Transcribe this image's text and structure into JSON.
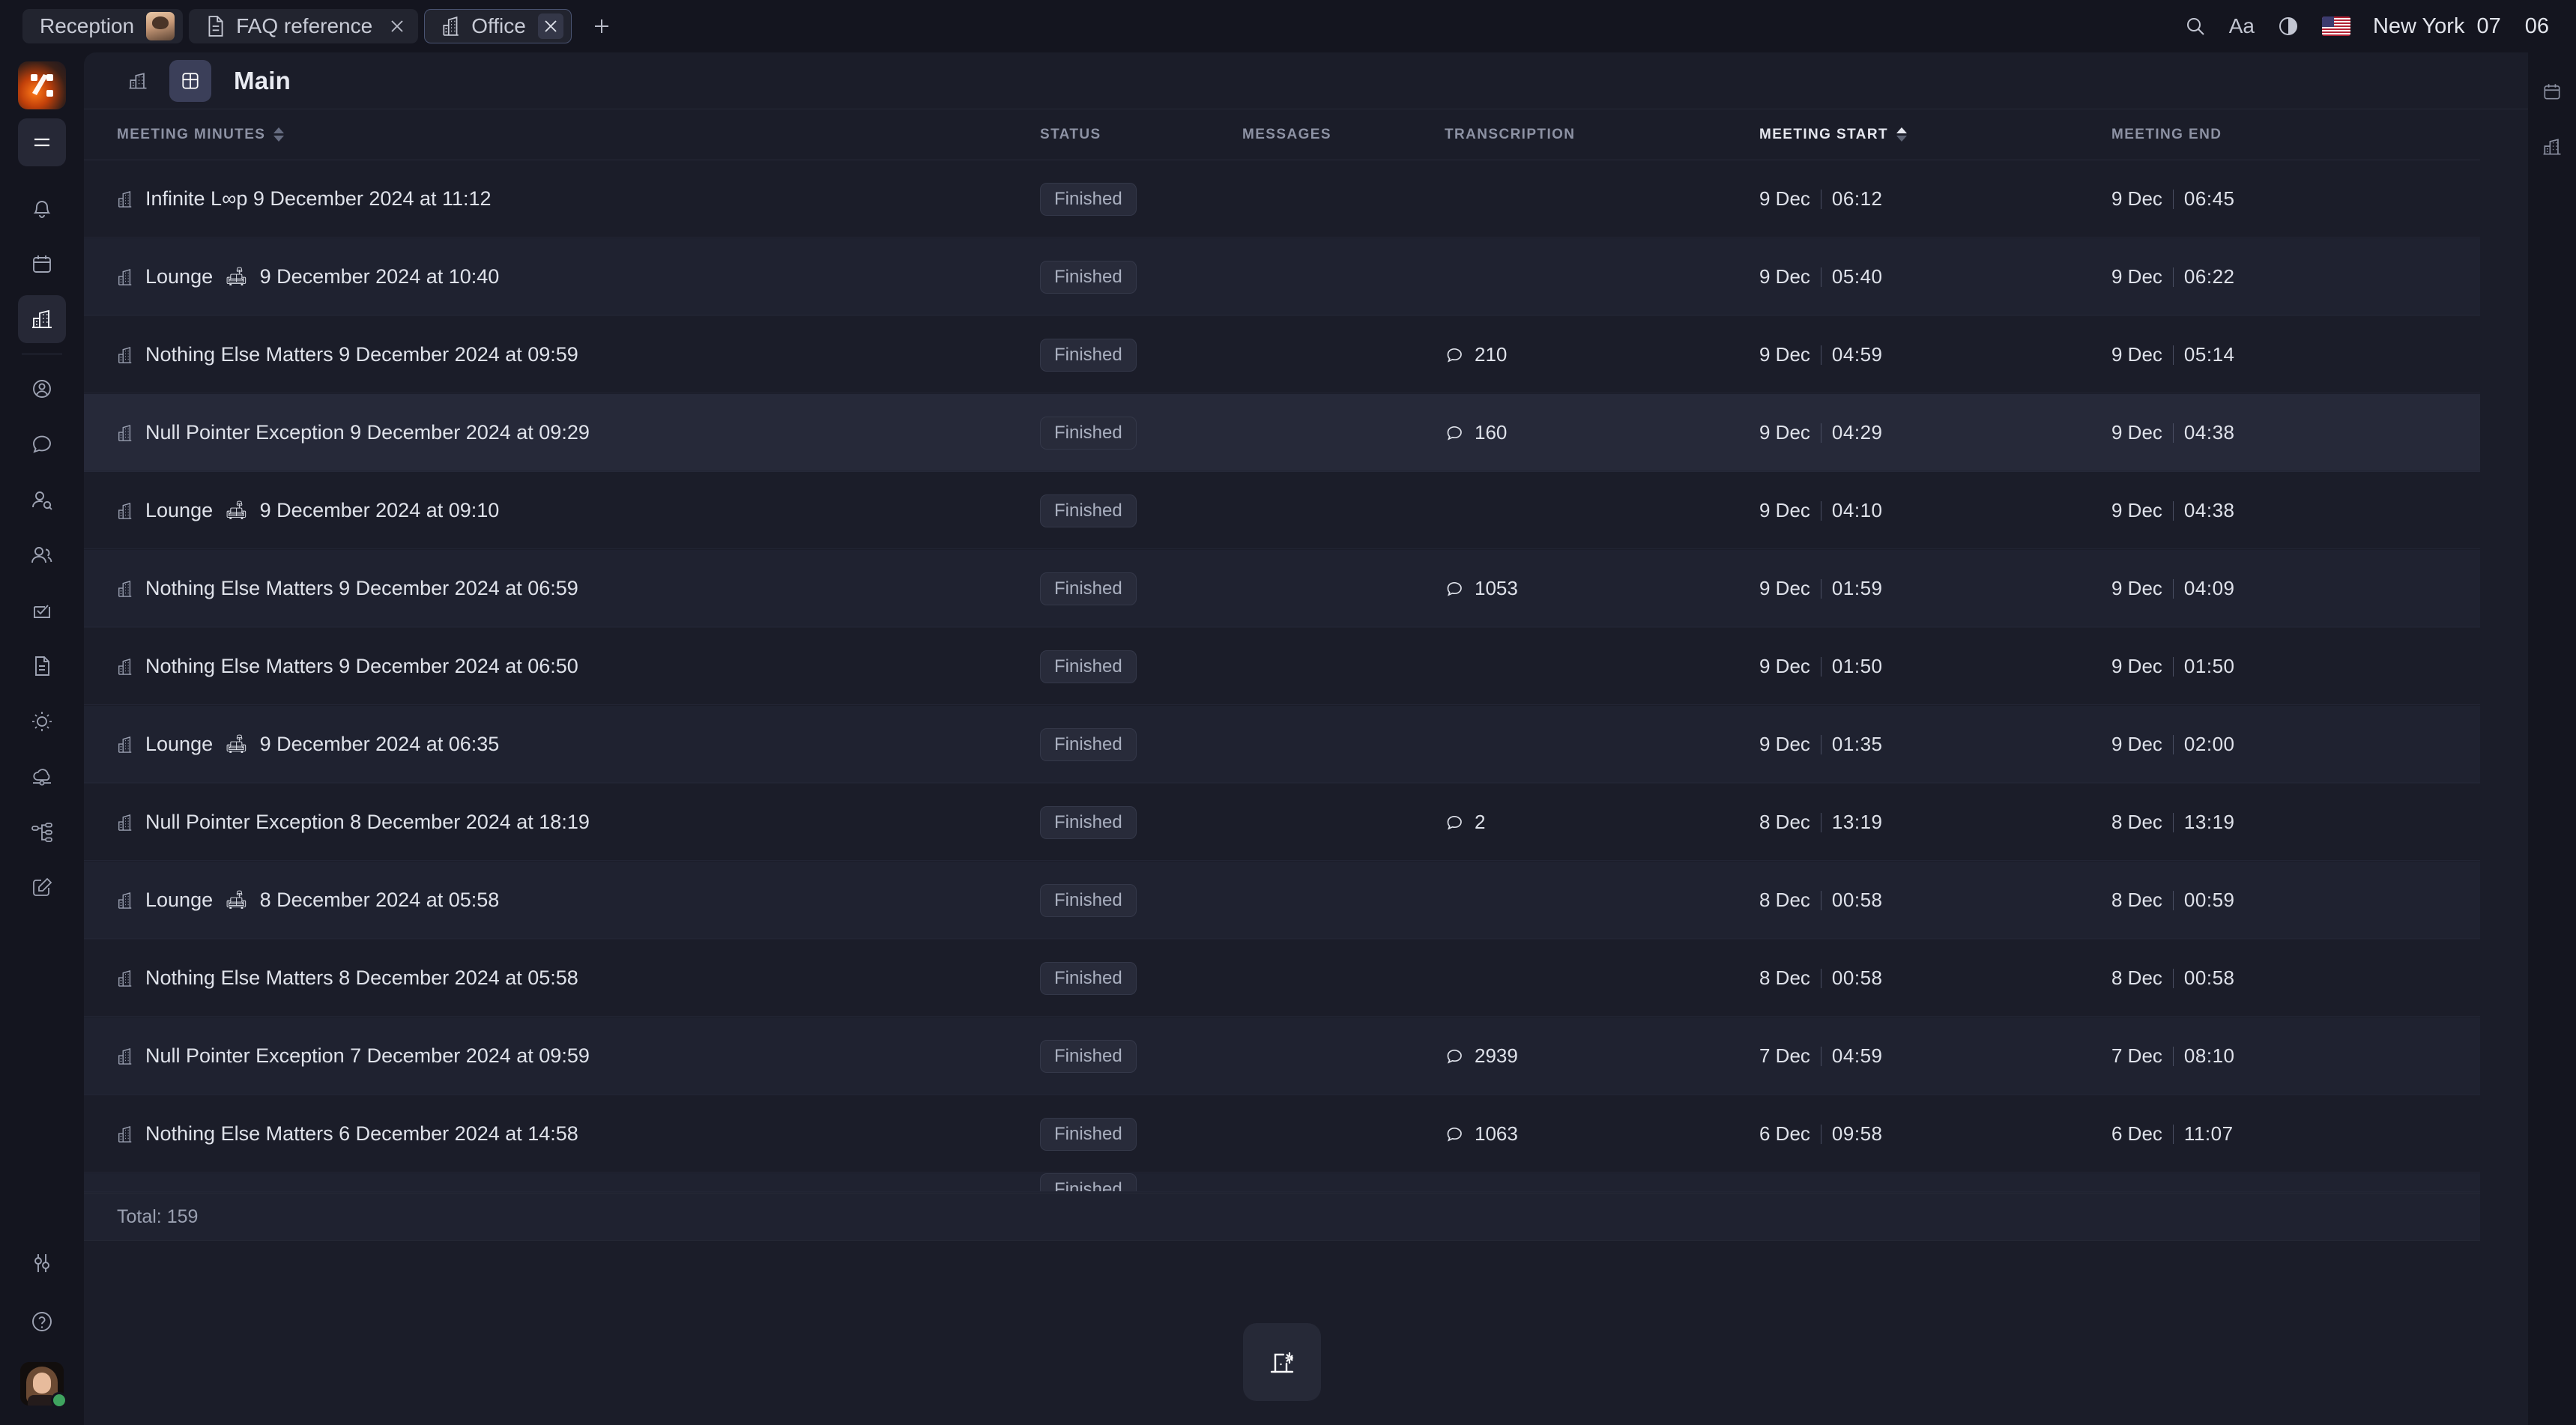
{
  "titlebar": {
    "tabs": [
      {
        "label": "Reception",
        "icon": "avatar-icon",
        "closable": false,
        "active": false
      },
      {
        "label": "FAQ reference",
        "icon": "document-icon",
        "closable": true,
        "active": false
      },
      {
        "label": "Office",
        "icon": "building-icon",
        "closable": true,
        "active": true
      }
    ],
    "new_tab_label": "+",
    "actions": [
      {
        "name": "search-icon",
        "label": ""
      },
      {
        "name": "text-size-icon",
        "label": "Aa"
      },
      {
        "name": "theme-contrast-icon",
        "label": ""
      },
      {
        "name": "flag-icon",
        "label": ""
      }
    ],
    "location": "New York",
    "time_hours": "07",
    "time_minutes": "06",
    "time_separator": " "
  },
  "sidebar": {
    "logo_name": "app-logo",
    "items": [
      {
        "name": "menu-toggle",
        "icon": "hamburger-icon",
        "active": false
      },
      {
        "name": "notifications",
        "icon": "bell-icon",
        "active": false
      },
      {
        "name": "calendar",
        "icon": "calendar-icon",
        "active": false
      },
      {
        "name": "office",
        "icon": "building-icon",
        "active": true
      },
      {
        "name": "contacts",
        "icon": "user-circle-icon",
        "active": false
      },
      {
        "name": "chat",
        "icon": "speech-bubble-icon",
        "active": false
      },
      {
        "name": "user-search",
        "icon": "user-search-icon",
        "active": false
      },
      {
        "name": "team",
        "icon": "users-icon",
        "active": false
      },
      {
        "name": "tasks",
        "icon": "checkbox-envelope-icon",
        "active": false
      },
      {
        "name": "documents",
        "icon": "file-text-icon",
        "active": false
      },
      {
        "name": "weather",
        "icon": "sun-icon",
        "active": false
      },
      {
        "name": "cloud-sync",
        "icon": "cloud-icon",
        "active": false
      },
      {
        "name": "org-chart",
        "icon": "hierarchy-icon",
        "active": false
      },
      {
        "name": "notes",
        "icon": "edit-square-icon",
        "active": false
      }
    ],
    "bottom_items": [
      {
        "name": "settings-sliders",
        "icon": "sliders-icon"
      },
      {
        "name": "help",
        "icon": "question-circle-icon"
      }
    ],
    "avatar_name": "user-avatar",
    "avatar_status": "online"
  },
  "right_rail": {
    "items": [
      {
        "name": "calendar-panel",
        "icon": "calendar-icon"
      },
      {
        "name": "office-panel",
        "icon": "building-icon"
      }
    ]
  },
  "panel": {
    "view_buttons": [
      {
        "name": "office-view",
        "icon": "building-icon",
        "selected": false
      },
      {
        "name": "table-view",
        "icon": "table-icon",
        "selected": true
      }
    ],
    "title": "Main"
  },
  "table": {
    "columns": [
      {
        "key": "meeting_minutes",
        "label": "Meeting minutes",
        "sortable": true,
        "sorted": false
      },
      {
        "key": "status",
        "label": "Status",
        "sortable": false,
        "sorted": false
      },
      {
        "key": "messages",
        "label": "Messages",
        "sortable": false,
        "sorted": false
      },
      {
        "key": "transcription",
        "label": "Transcription",
        "sortable": false,
        "sorted": false
      },
      {
        "key": "meeting_start",
        "label": "Meeting start",
        "sortable": true,
        "sorted": true
      },
      {
        "key": "meeting_end",
        "label": "Meeting end",
        "sortable": false,
        "sorted": false
      }
    ],
    "rows": [
      {
        "title": "Infinite L∞p 9 December 2024 at 11:12",
        "emoji": "",
        "status": "Finished",
        "messages": "",
        "transcription": "",
        "start_date": "9 Dec",
        "start_time": "06:12",
        "end_date": "9 Dec",
        "end_time": "06:45"
      },
      {
        "title": "Lounge",
        "emoji": "🛋",
        "title_suffix": "9 December 2024 at 10:40",
        "status": "Finished",
        "messages": "",
        "transcription": "",
        "start_date": "9 Dec",
        "start_time": "05:40",
        "end_date": "9 Dec",
        "end_time": "06:22"
      },
      {
        "title": "Nothing Else Matters 9 December 2024 at 09:59",
        "emoji": "",
        "status": "Finished",
        "messages": "",
        "transcription": "210",
        "start_date": "9 Dec",
        "start_time": "04:59",
        "end_date": "9 Dec",
        "end_time": "05:14"
      },
      {
        "title": "Null Pointer Exception 9 December 2024 at 09:29",
        "emoji": "",
        "status": "Finished",
        "messages": "",
        "transcription": "160",
        "start_date": "9 Dec",
        "start_time": "04:29",
        "end_date": "9 Dec",
        "end_time": "04:38"
      },
      {
        "title": "Lounge",
        "emoji": "🛋",
        "title_suffix": "9 December 2024 at 09:10",
        "status": "Finished",
        "messages": "",
        "transcription": "",
        "start_date": "9 Dec",
        "start_time": "04:10",
        "end_date": "9 Dec",
        "end_time": "04:38"
      },
      {
        "title": "Nothing Else Matters 9 December 2024 at 06:59",
        "emoji": "",
        "status": "Finished",
        "messages": "",
        "transcription": "1053",
        "start_date": "9 Dec",
        "start_time": "01:59",
        "end_date": "9 Dec",
        "end_time": "04:09"
      },
      {
        "title": "Nothing Else Matters 9 December 2024 at 06:50",
        "emoji": "",
        "status": "Finished",
        "messages": "",
        "transcription": "",
        "start_date": "9 Dec",
        "start_time": "01:50",
        "end_date": "9 Dec",
        "end_time": "01:50"
      },
      {
        "title": "Lounge",
        "emoji": "🛋",
        "title_suffix": "9 December 2024 at 06:35",
        "status": "Finished",
        "messages": "",
        "transcription": "",
        "start_date": "9 Dec",
        "start_time": "01:35",
        "end_date": "9 Dec",
        "end_time": "02:00"
      },
      {
        "title": "Null Pointer Exception 8 December 2024 at 18:19",
        "emoji": "",
        "status": "Finished",
        "messages": "",
        "transcription": "2",
        "start_date": "8 Dec",
        "start_time": "13:19",
        "end_date": "8 Dec",
        "end_time": "13:19"
      },
      {
        "title": "Lounge",
        "emoji": "🛋",
        "title_suffix": "8 December 2024 at 05:58",
        "status": "Finished",
        "messages": "",
        "transcription": "",
        "start_date": "8 Dec",
        "start_time": "00:58",
        "end_date": "8 Dec",
        "end_time": "00:59"
      },
      {
        "title": "Nothing Else Matters 8 December 2024 at 05:58",
        "emoji": "",
        "status": "Finished",
        "messages": "",
        "transcription": "",
        "start_date": "8 Dec",
        "start_time": "00:58",
        "end_date": "8 Dec",
        "end_time": "00:58"
      },
      {
        "title": "Null Pointer Exception 7 December 2024 at 09:59",
        "emoji": "",
        "status": "Finished",
        "messages": "",
        "transcription": "2939",
        "start_date": "7 Dec",
        "start_time": "04:59",
        "end_date": "7 Dec",
        "end_time": "08:10"
      },
      {
        "title": "Nothing Else Matters 6 December 2024 at 14:58",
        "emoji": "",
        "status": "Finished",
        "messages": "",
        "transcription": "1063",
        "start_date": "6 Dec",
        "start_time": "09:58",
        "end_date": "6 Dec",
        "end_time": "11:07"
      }
    ],
    "total_label": "Total: 159"
  },
  "fab": {
    "name": "new-meeting-minutes-button",
    "icon": "new-doc-sparkle-icon"
  },
  "colors": {
    "app_bg": "#14151f",
    "panel_bg": "#1b1d29",
    "row_alt": "#1f2230",
    "row_highlight": "#262939",
    "accent": "#3b3f59",
    "text_primary": "#dfe2ea",
    "text_muted": "#8d92a4",
    "status_online": "#3fa45f"
  }
}
